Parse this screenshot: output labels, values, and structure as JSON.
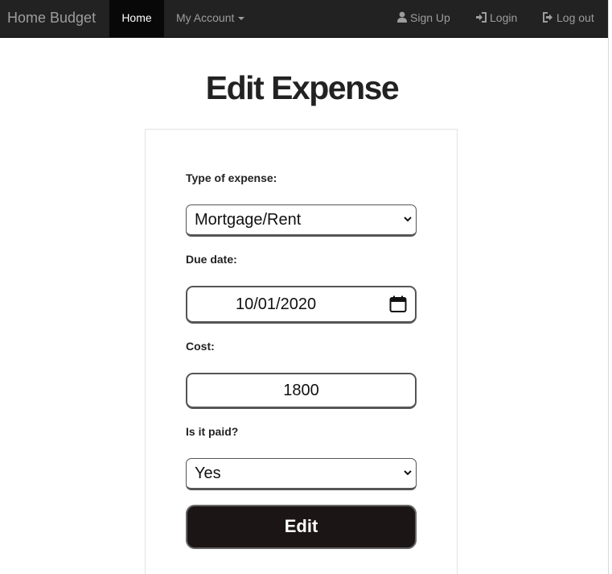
{
  "navbar": {
    "brand": "Home Budget",
    "home": "Home",
    "account": "My Account",
    "signup": "Sign Up",
    "login": "Login",
    "logout": "Log out"
  },
  "page": {
    "title": "Edit Expense"
  },
  "form": {
    "type_label": "Type of expense:",
    "type_value": "Mortgage/Rent",
    "due_label": "Due date:",
    "due_value": "10/01/2020",
    "cost_label": "Cost:",
    "cost_value": "1800",
    "paid_label": "Is it paid?",
    "paid_value": "Yes",
    "submit_label": "Edit"
  },
  "icons": {
    "signup": "user-icon",
    "login": "log-in-icon",
    "logout": "log-out-icon",
    "account_menu": "caret-down-icon",
    "select": "chevron-down-icon",
    "date": "calendar-icon"
  },
  "colors": {
    "navbar": "#222222",
    "active_nav": "#080808",
    "button": "#1c1515"
  }
}
